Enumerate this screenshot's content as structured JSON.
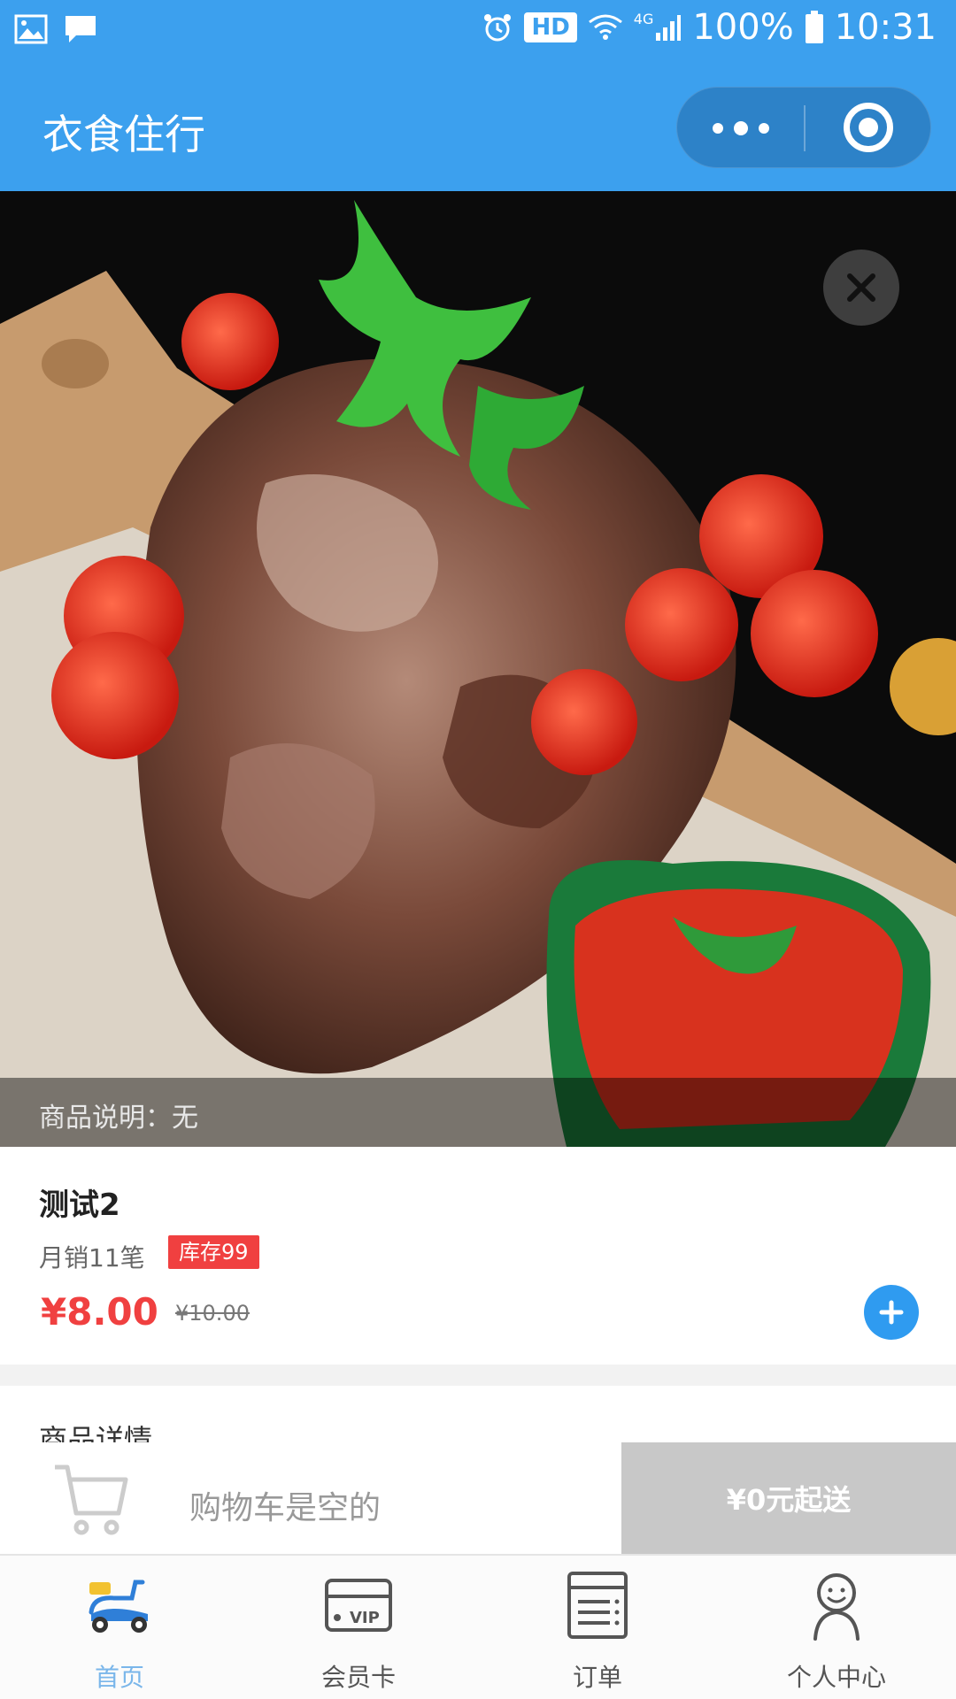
{
  "status_bar": {
    "network": "4G",
    "hd": "HD",
    "battery": "100%",
    "time": "10:31"
  },
  "header": {
    "title": "衣食住行"
  },
  "hero": {
    "caption": "商品说明：无"
  },
  "product": {
    "name": "测试2",
    "sales": "月销11笔",
    "stock": "库存99",
    "price": "¥8.00",
    "original_price": "¥10.00"
  },
  "detail": {
    "section_title": "商品详情"
  },
  "cart": {
    "empty_text": "购物车是空的",
    "min_order": "¥0元起送"
  },
  "tabs": [
    {
      "label": "首页",
      "icon": "scooter-icon",
      "active": true
    },
    {
      "label": "会员卡",
      "icon": "vip-card-icon",
      "active": false
    },
    {
      "label": "订单",
      "icon": "order-list-icon",
      "active": false
    },
    {
      "label": "个人中心",
      "icon": "profile-icon",
      "active": false
    }
  ],
  "colors": {
    "brand_blue": "#3ca0ee",
    "price_red": "#f04040",
    "active_tab": "#7ab6ea"
  }
}
